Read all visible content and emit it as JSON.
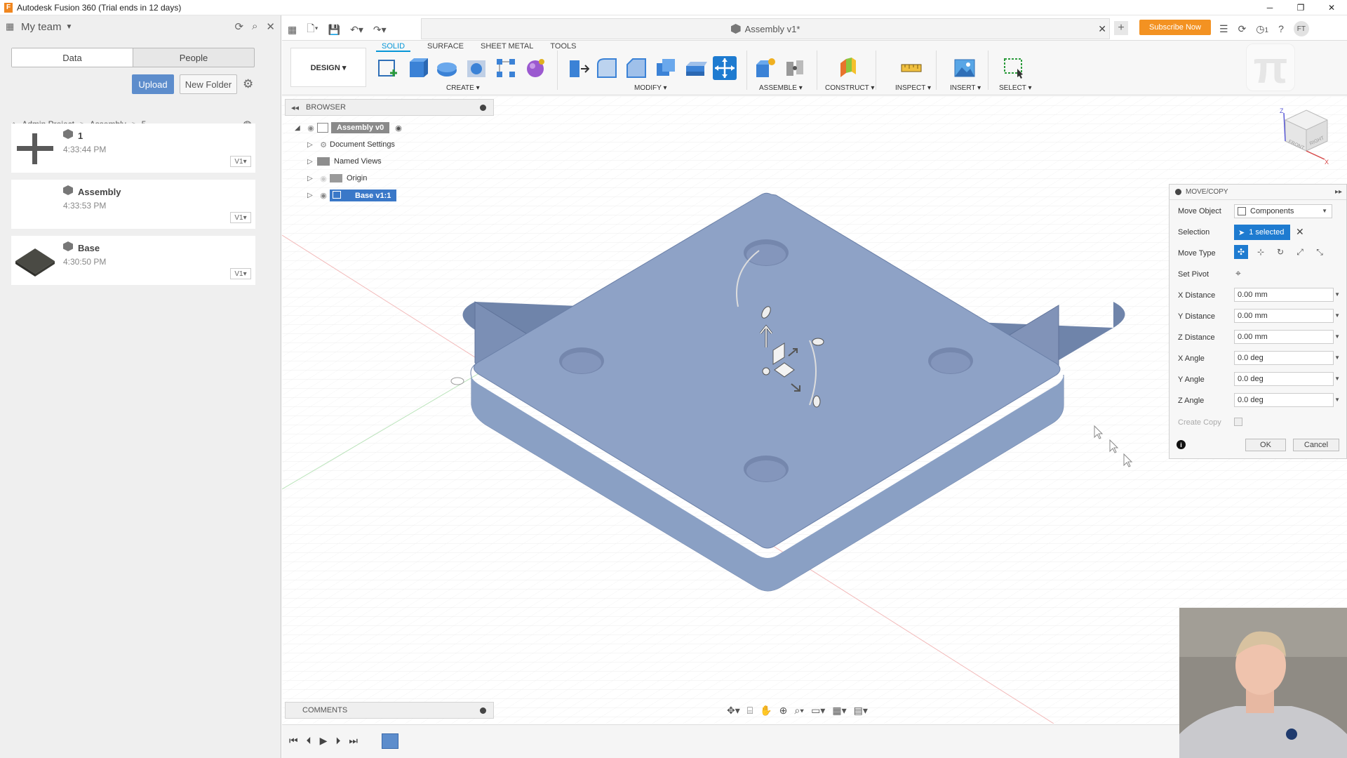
{
  "window": {
    "title": "Autodesk Fusion 360 (Trial ends in 12 days)",
    "app_icon": "F"
  },
  "data_panel": {
    "team": "My team",
    "tabs": [
      "Data",
      "People"
    ],
    "upload_label": "Upload",
    "new_folder_label": "New Folder",
    "breadcrumb": [
      "Admin Project",
      "Assembly",
      "5"
    ],
    "items": [
      {
        "name": "1",
        "time": "4:33:44 PM",
        "version": "V1▾"
      },
      {
        "name": "Assembly",
        "time": "4:33:53 PM",
        "version": "V1▾"
      },
      {
        "name": "Base",
        "time": "4:30:50 PM",
        "version": "V1▾"
      }
    ]
  },
  "document_tab": {
    "title": "Assembly v1*"
  },
  "topbar": {
    "subscribe_label": "Subscribe Now",
    "notifications_count": "1",
    "user_initials": "FT"
  },
  "ribbon": {
    "workspace": "DESIGN ▾",
    "tabs": [
      "SOLID",
      "SURFACE",
      "SHEET METAL",
      "TOOLS"
    ],
    "groups": [
      "CREATE ▾",
      "MODIFY ▾",
      "ASSEMBLE ▾",
      "CONSTRUCT ▾",
      "INSPECT ▾",
      "INSERT ▾",
      "SELECT ▾"
    ]
  },
  "browser": {
    "title": "BROWSER",
    "root": "Assembly v0",
    "nodes": [
      "Document Settings",
      "Named Views",
      "Origin",
      "Base v1:1"
    ]
  },
  "comments": {
    "title": "COMMENTS"
  },
  "move_copy": {
    "title": "MOVE/COPY",
    "rows": {
      "move_object": {
        "label": "Move Object",
        "value": "Components"
      },
      "selection": {
        "label": "Selection",
        "value": "1 selected"
      },
      "move_type": {
        "label": "Move Type"
      },
      "set_pivot": {
        "label": "Set Pivot"
      },
      "x_distance": {
        "label": "X Distance",
        "value": "0.00 mm"
      },
      "y_distance": {
        "label": "Y Distance",
        "value": "0.00 mm"
      },
      "z_distance": {
        "label": "Z Distance",
        "value": "0.00 mm"
      },
      "x_angle": {
        "label": "X Angle",
        "value": "0.0 deg"
      },
      "y_angle": {
        "label": "Y Angle",
        "value": "0.0 deg"
      },
      "z_angle": {
        "label": "Z Angle",
        "value": "0.0 deg"
      },
      "create_copy": {
        "label": "Create Copy",
        "checked": false
      }
    },
    "ok_label": "OK",
    "cancel_label": "Cancel"
  },
  "viewcube": {
    "faces": [
      "FRONT",
      "RIGHT"
    ],
    "axes": [
      "Z",
      "X"
    ]
  },
  "colors": {
    "accent": "#0696d7",
    "selection_blue": "#1e7bd0",
    "model": "#8fa3c9",
    "subscribe": "#f39222"
  }
}
